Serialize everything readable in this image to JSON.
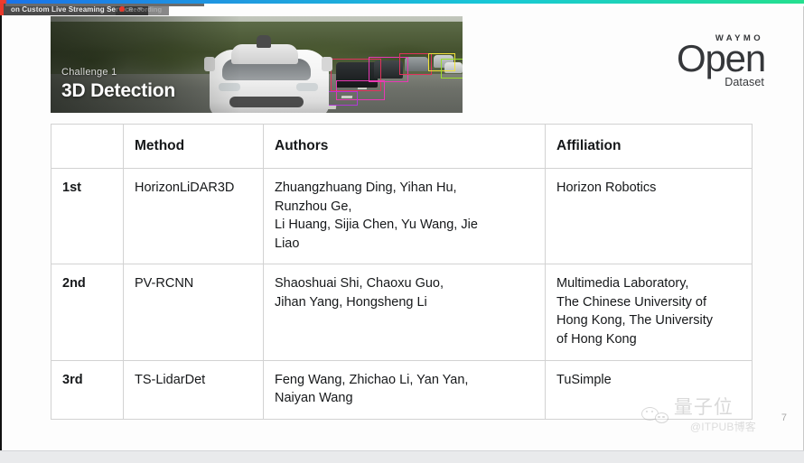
{
  "browser": {
    "progress_bar": {
      "accent_red": "#ef3b2c",
      "accent_blue": "#1a73e8",
      "accent_cyan": "#18c9d6",
      "accent_green": "#25e08f"
    },
    "stream_chip_label": "on Custom Live Streaming Service",
    "stream_chip_caret": "chevron-down-icon",
    "recording_label": "Recording"
  },
  "hero": {
    "kicker": "Challenge 1",
    "title": "3D Detection",
    "detection_box_colors": [
      "#e0335c",
      "#e838b4",
      "#f2e23a",
      "#9ae02f",
      "#b03ad6"
    ]
  },
  "logo": {
    "waymo": "WAYMO",
    "open": "Open",
    "dataset": "Dataset",
    "color": "#35373a"
  },
  "table": {
    "headers": [
      "",
      "Method",
      "Authors",
      "Affiliation"
    ],
    "rows": [
      {
        "rank": "1st",
        "method": "HorizonLiDAR3D",
        "authors": "Zhuangzhuang Ding, Yihan Hu,\nRunzhou Ge,\nLi Huang, Sijia Chen, Yu Wang, Jie\nLiao",
        "affiliation": "Horizon Robotics"
      },
      {
        "rank": "2nd",
        "method": "PV-RCNN",
        "authors": "Shaoshuai Shi, Chaoxu Guo,\nJihan Yang, Hongsheng Li",
        "affiliation": "Multimedia Laboratory,\nThe Chinese University of\nHong Kong, The University\nof Hong Kong"
      },
      {
        "rank": "3rd",
        "method": "TS-LidarDet",
        "authors": "Feng Wang, Zhichao Li, Yan Yan,\nNaiyan Wang",
        "affiliation": "TuSimple"
      }
    ]
  },
  "watermark": {
    "icon": "wechat-icon",
    "brand": "量子位",
    "handle": "@ITPUB博客"
  },
  "page_number": "7"
}
